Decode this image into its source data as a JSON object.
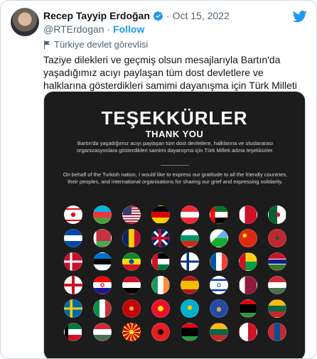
{
  "author": {
    "name": "Recep Tayyip Erdoğan",
    "handle": "@RTErdogan",
    "follow_label": "Follow",
    "date": "Oct 15, 2022",
    "separator": "·",
    "account_label": "Türkiye devlet görevlisi"
  },
  "tweet_text": "Taziye dilekleri ve geçmiş olsun mesajlarıyla Bartın'da yaşadığımız acıyı paylaşan tüm dost devletlere ve halklarına gösterdikleri samimi dayanışma için Türk Milleti adına şükranlarımı ifade ediyorum.",
  "media": {
    "title": "TEŞEKKÜRLER",
    "subtitle": "THANK YOU",
    "turkish_text": "Bartın'da yaşadığımız acıyı paylaşan tüm dost devletlere, halklarına ve uluslararası organizasyonlara gösterdikleri samimi dayanışma için Türk Milleti adına teşekkürler.",
    "english_text": "On behalf of the Turkish nation, I would like to express our gratitude to all the friendly countries, their peoples, and international organisations for sharing our grief and expressing solidarity."
  },
  "flags": [
    "northern-cyprus",
    "azerbaijan",
    "usa",
    "germany",
    "austria",
    "uae",
    "bahrain",
    "algeria",
    "el-salvador",
    "belarus",
    "chad",
    "uk",
    "bulgaria",
    "djibouti",
    "china",
    "morocco",
    "denmark",
    "estonia",
    "ethiopia",
    "palestine",
    "finland",
    "france",
    "guinea-bissau",
    "gambia",
    "england",
    "croatia",
    "iraq",
    "ireland",
    "spain",
    "israel",
    "qatar",
    "hungary",
    "sweden",
    "italy",
    "montenegro",
    "kyrgyzstan",
    "kazakhstan",
    "kosovo",
    "libya",
    "lithuania",
    "kuwait",
    "hungary-2",
    "north-macedonia",
    "albania",
    "libya-2",
    "lithuania-2",
    "malta",
    "mongolia"
  ],
  "colors": {
    "accent": "#1d9bf0",
    "secondary_text": "#536471",
    "media_bg": "#1c1c1c"
  }
}
